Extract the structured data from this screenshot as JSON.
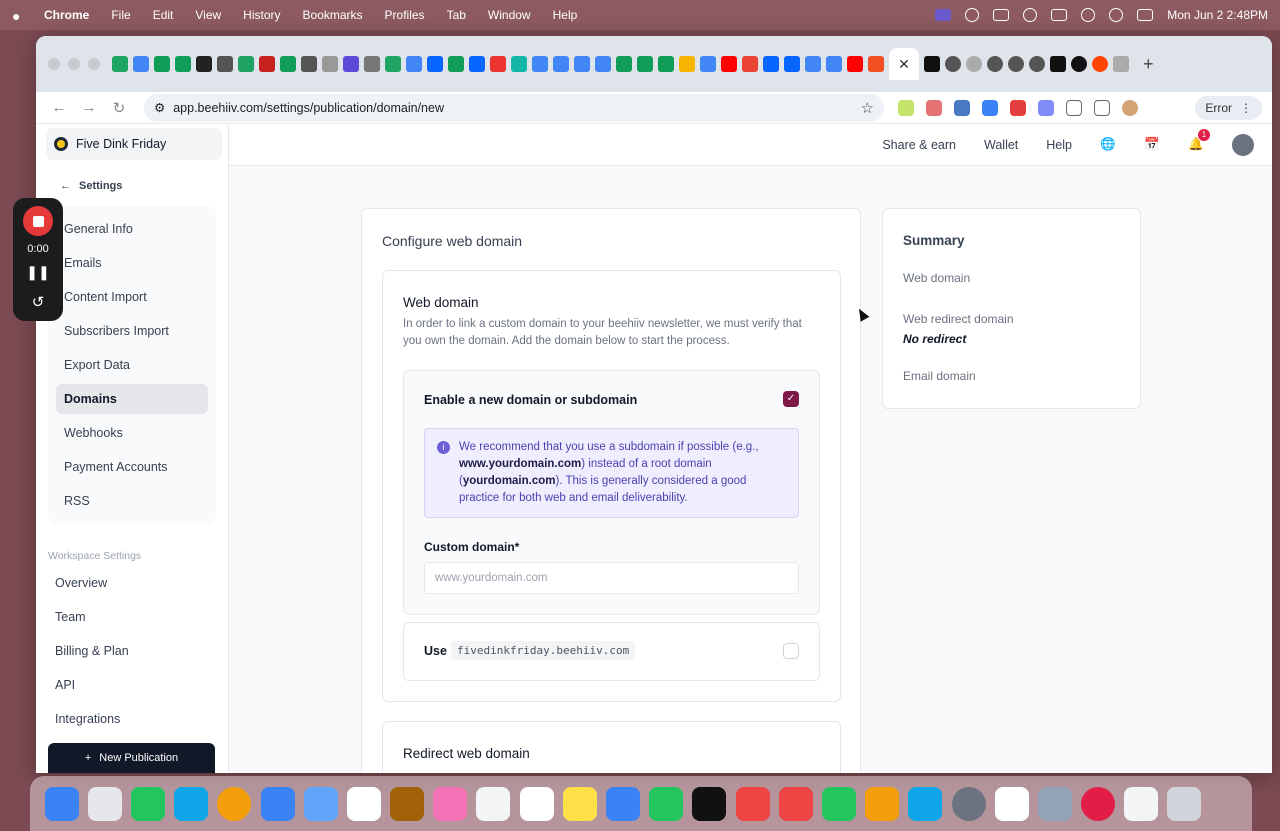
{
  "menubar": {
    "app_name": "Chrome",
    "items": [
      "File",
      "Edit",
      "View",
      "History",
      "Bookmarks",
      "Profiles",
      "Tab",
      "Window",
      "Help"
    ],
    "clock": "Mon Jun 2  2:48PM"
  },
  "browser": {
    "url": "app.beehiiv.com/settings/publication/domain/new",
    "error_label": "Error",
    "close_tab": "✕"
  },
  "app": {
    "publication_name": "Five Dink Friday",
    "back_label": "Settings",
    "settings_nav": [
      {
        "label": "General Info"
      },
      {
        "label": "Emails"
      },
      {
        "label": "Content Import"
      },
      {
        "label": "Subscribers Import"
      },
      {
        "label": "Export Data"
      },
      {
        "label": "Domains"
      },
      {
        "label": "Webhooks"
      },
      {
        "label": "Payment Accounts"
      },
      {
        "label": "RSS"
      }
    ],
    "workspace_label": "Workspace Settings",
    "workspace_nav": [
      {
        "label": "Overview"
      },
      {
        "label": "Team"
      },
      {
        "label": "Billing & Plan"
      },
      {
        "label": "API"
      },
      {
        "label": "Integrations"
      }
    ],
    "new_publication": "New Publication",
    "topnav": {
      "share": "Share & earn",
      "wallet": "Wallet",
      "help": "Help",
      "notification_count": "1"
    }
  },
  "configure": {
    "title": "Configure web domain",
    "section_title": "Web domain",
    "description": "In order to link a custom domain to your beehiiv newsletter, we must verify that you own the domain. Add the domain below to start the process.",
    "enable_label": "Enable a new domain or subdomain",
    "enable_checked": true,
    "info_parts": {
      "p1": "We recommend that you use a subdomain if possible (e.g., ",
      "b1": "www.yourdomain.com",
      "p2": ") instead of a root domain (",
      "b2": "yourdomain.com",
      "p3": "). This is generally considered a good practice for both web and email deliverability."
    },
    "custom_domain_label": "Custom domain*",
    "custom_domain_placeholder": "www.yourdomain.com",
    "custom_domain_value": "",
    "use_label": "Use",
    "use_domain": "fivedinkfriday.beehiiv.com",
    "use_checked": false,
    "redirect_title": "Redirect web domain"
  },
  "summary": {
    "title": "Summary",
    "web_domain": "Web domain",
    "web_redirect_domain": "Web redirect domain",
    "no_redirect": "No redirect",
    "email_domain": "Email domain"
  },
  "recorder": {
    "time": "0:00"
  },
  "colors": {
    "accent": "#7e1a4a",
    "info_bg": "#efeefe",
    "info_text": "#4c3fb0"
  }
}
